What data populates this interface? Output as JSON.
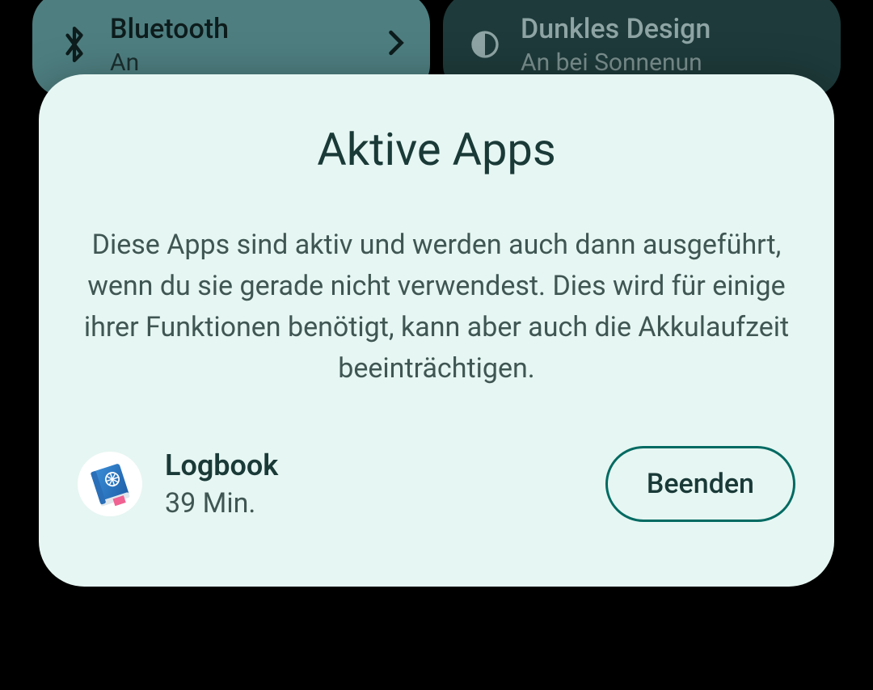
{
  "quicksettings": {
    "bluetooth": {
      "title": "Bluetooth",
      "status": "An"
    },
    "darkmode": {
      "title": "Dunkles Design",
      "status": "An bei Sonnenun"
    }
  },
  "modal": {
    "title": "Aktive Apps",
    "description": "Diese Apps sind aktiv und werden auch dann ausgeführt, wenn du sie gerade nicht verwendest. Dies wird für einige ihrer Funktionen benötigt, kann aber auch die Akkulaufzeit beeinträchtigen.",
    "apps": [
      {
        "name": "Logbook",
        "duration": "39 Min.",
        "stop_label": "Beenden"
      }
    ]
  }
}
